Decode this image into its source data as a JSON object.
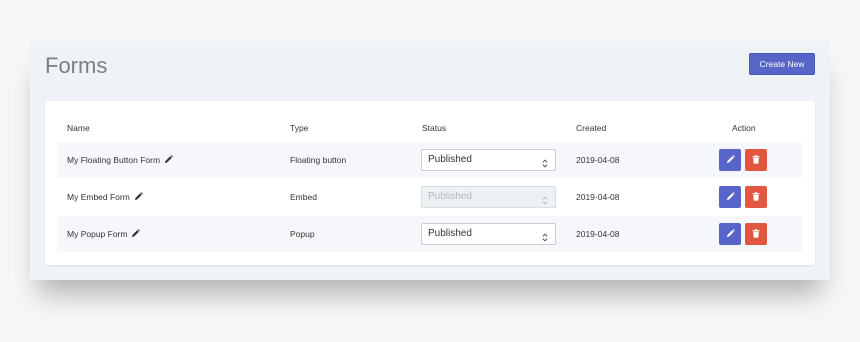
{
  "header": {
    "title": "Forms",
    "create_label": "Create New"
  },
  "table": {
    "columns": [
      "Name",
      "Type",
      "Status",
      "Created",
      "Action"
    ],
    "rows": [
      {
        "name": "My Floating Button Form",
        "type": "Floating button",
        "status": "Published",
        "status_disabled": false,
        "created": "2019-04-08"
      },
      {
        "name": "My Embed Form",
        "type": "Embed",
        "status": "Published",
        "status_disabled": true,
        "created": "2019-04-08"
      },
      {
        "name": "My Popup Form",
        "type": "Popup",
        "status": "Published",
        "status_disabled": false,
        "created": "2019-04-08"
      }
    ]
  },
  "icons": {
    "name_edit": "pencil-icon",
    "select": "chevron-updown-icon",
    "edit": "pencil-icon",
    "delete": "trash-icon"
  },
  "colors": {
    "primary": "#5865c8",
    "danger": "#e2573f",
    "background": "#eff3f7"
  }
}
